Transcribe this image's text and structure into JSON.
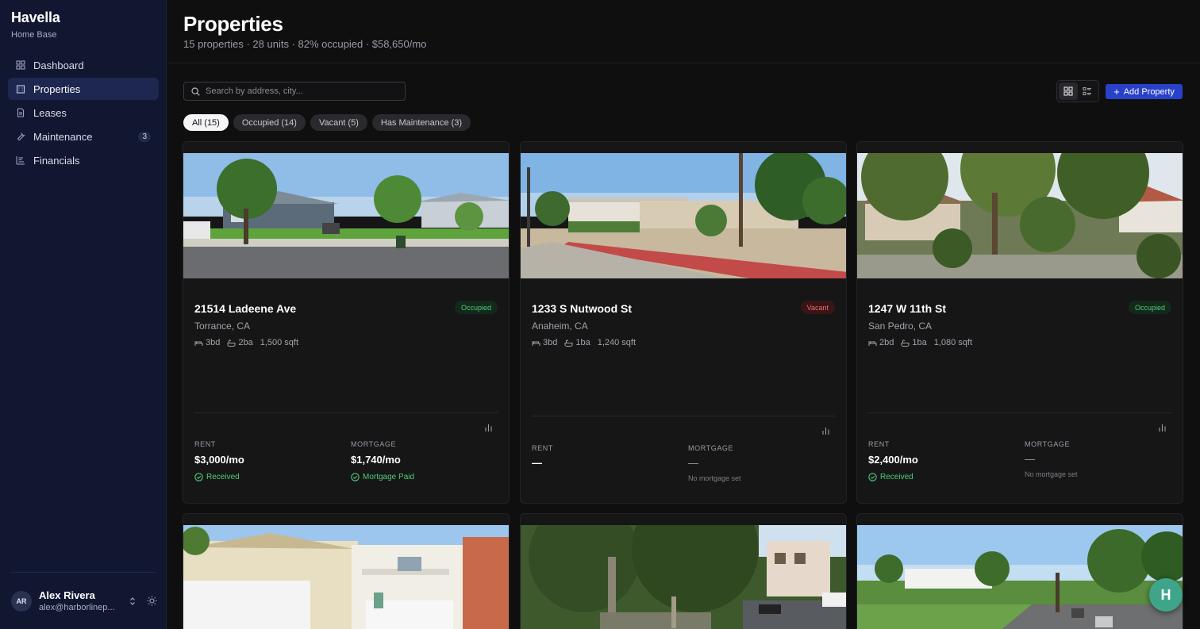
{
  "brand": {
    "name": "Havella",
    "subtitle": "Home Base"
  },
  "nav": [
    {
      "label": "Dashboard",
      "icon": "dashboard-grid-icon",
      "active": false
    },
    {
      "label": "Properties",
      "icon": "building-icon",
      "active": true
    },
    {
      "label": "Leases",
      "icon": "document-icon",
      "active": false
    },
    {
      "label": "Maintenance",
      "icon": "wrench-icon",
      "active": false,
      "badge": "3"
    },
    {
      "label": "Financials",
      "icon": "bar-chart-icon",
      "active": false
    }
  ],
  "user": {
    "initials": "AR",
    "name": "Alex Rivera",
    "email": "alex@harborlinep..."
  },
  "page": {
    "title": "Properties",
    "subtitle": "15 properties · 28 units · 82% occupied · $58,650/mo"
  },
  "search": {
    "placeholder": "Search by address, city..."
  },
  "toolbar": {
    "add_label": "Add Property",
    "view": "grid"
  },
  "filters": [
    {
      "label": "All (15)",
      "active": true
    },
    {
      "label": "Occupied (14)",
      "active": false
    },
    {
      "label": "Vacant (5)",
      "active": false
    },
    {
      "label": "Has Maintenance (3)",
      "active": false
    }
  ],
  "labels": {
    "rent": "RENT",
    "mortgage": "MORTGAGE"
  },
  "cards": [
    {
      "title": "21514 Ladeene Ave",
      "city": "Torrance, CA",
      "beds": "3bd",
      "baths": "2ba",
      "sqft": "1,500 sqft",
      "status": "Occupied",
      "rent": "$3,000/mo",
      "rent_status": "Received",
      "mortgage": "$1,740/mo",
      "mortgage_status": "Mortgage Paid"
    },
    {
      "title": "1233 S Nutwood St",
      "city": "Anaheim, CA",
      "beds": "3bd",
      "baths": "1ba",
      "sqft": "1,240 sqft",
      "status": "Vacant",
      "rent": "—",
      "mortgage": "—",
      "mortgage_note": "No mortgage set"
    },
    {
      "title": "1247 W 11th St",
      "city": "San Pedro, CA",
      "beds": "2bd",
      "baths": "1ba",
      "sqft": "1,080 sqft",
      "status": "Occupied",
      "rent": "$2,400/mo",
      "rent_status": "Received",
      "mortgage": "—",
      "mortgage_note": "No mortgage set"
    }
  ],
  "fab": {
    "label": "H"
  },
  "colors": {
    "accent": "#2941c8",
    "sidebar": "#111731",
    "occupied": "#4fcd78",
    "vacant": "#ef6b6b"
  }
}
